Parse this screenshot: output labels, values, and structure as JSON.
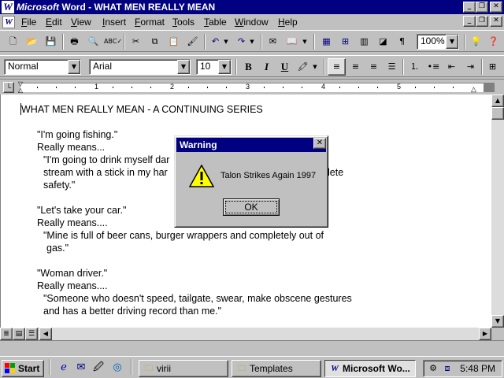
{
  "window": {
    "title_app": "Microsoft",
    "title_rest": " Word - WHAT MEN REALLY MEAN",
    "app_icon": "W",
    "minimize_glyph": "_",
    "maximize_glyph": "❐",
    "close_glyph": "✕"
  },
  "menu": {
    "doc_icon": "W",
    "items": [
      "File",
      "Edit",
      "View",
      "Insert",
      "Format",
      "Tools",
      "Table",
      "Window",
      "Help"
    ]
  },
  "standard_toolbar": {
    "icons": [
      "new-icon",
      "open-icon",
      "save-icon",
      "print-icon",
      "print-preview-icon",
      "spelling-icon",
      "cut-icon",
      "copy-icon",
      "paste-icon",
      "format-painter-icon",
      "undo-icon",
      "redo-icon",
      "insert-address-icon",
      "insert-hyperlink-icon",
      "tables-borders-icon",
      "insert-table-icon",
      "columns-icon",
      "drawing-icon",
      "show-hide-icon",
      "tip-wizard-icon",
      "help-icon"
    ],
    "zoom": "100%"
  },
  "format_toolbar": {
    "style": "Normal",
    "font": "Arial",
    "size": "10",
    "bold": "B",
    "italic": "I",
    "underline": "U"
  },
  "ruler": {
    "numbers": [
      "1",
      "2",
      "3",
      "4",
      "5"
    ]
  },
  "document": {
    "lines": [
      "WHAT MEN REALLY MEAN - A CONTINUING SERIES",
      "\"I'm going fishing.\"",
      "Really means...",
      "\"I'm going to drink myself dar",
      "stream with a stick in my har",
      "safety.\"",
      "\"Let's take your car.\"",
      "Really means....",
      "\"Mine is full of beer cans, burger wrappers and completely out of",
      "gas.\"",
      "\"Woman driver.\"",
      "Really means....",
      "\"Someone who doesn't speed, tailgate, swear, make obscene gestures",
      "and has a better driving record than me.\""
    ],
    "partial_right_text": "lete"
  },
  "dialog": {
    "title": "Warning",
    "message": "Talon Strikes Again 1997",
    "ok_label": "OK"
  },
  "taskbar": {
    "start_label": "Start",
    "quick_launch": [
      "ie-icon",
      "outlook-icon",
      "desktop-icon",
      "channels-icon"
    ],
    "tasks": [
      {
        "label": "virii",
        "icon": "folder-icon"
      },
      {
        "label": "Templates",
        "icon": "folder-icon"
      },
      {
        "label": "Microsoft Wo...",
        "icon": "word-icon"
      }
    ],
    "clock": "5:48 PM"
  },
  "colors": {
    "titlebar": "#000080",
    "face": "#c0c0c0",
    "page": "#ffffff"
  }
}
